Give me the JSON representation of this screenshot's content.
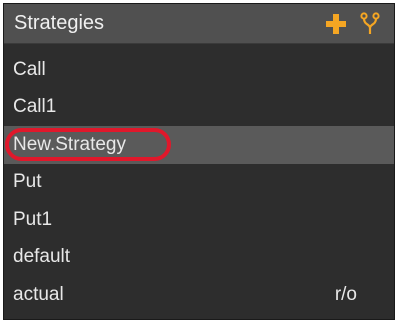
{
  "panel": {
    "title": "Strategies",
    "add_icon": "plus-icon",
    "fork_icon": "branch-icon",
    "accent_color": "#f5a623"
  },
  "strategies": [
    {
      "label": "Call",
      "badge": "",
      "selected": false
    },
    {
      "label": "Call1",
      "badge": "",
      "selected": false
    },
    {
      "label": "New.Strategy",
      "badge": "",
      "selected": true
    },
    {
      "label": "Put",
      "badge": "",
      "selected": false
    },
    {
      "label": "Put1",
      "badge": "",
      "selected": false
    },
    {
      "label": "default",
      "badge": "",
      "selected": false
    },
    {
      "label": "actual",
      "badge": "r/o",
      "selected": false
    }
  ]
}
